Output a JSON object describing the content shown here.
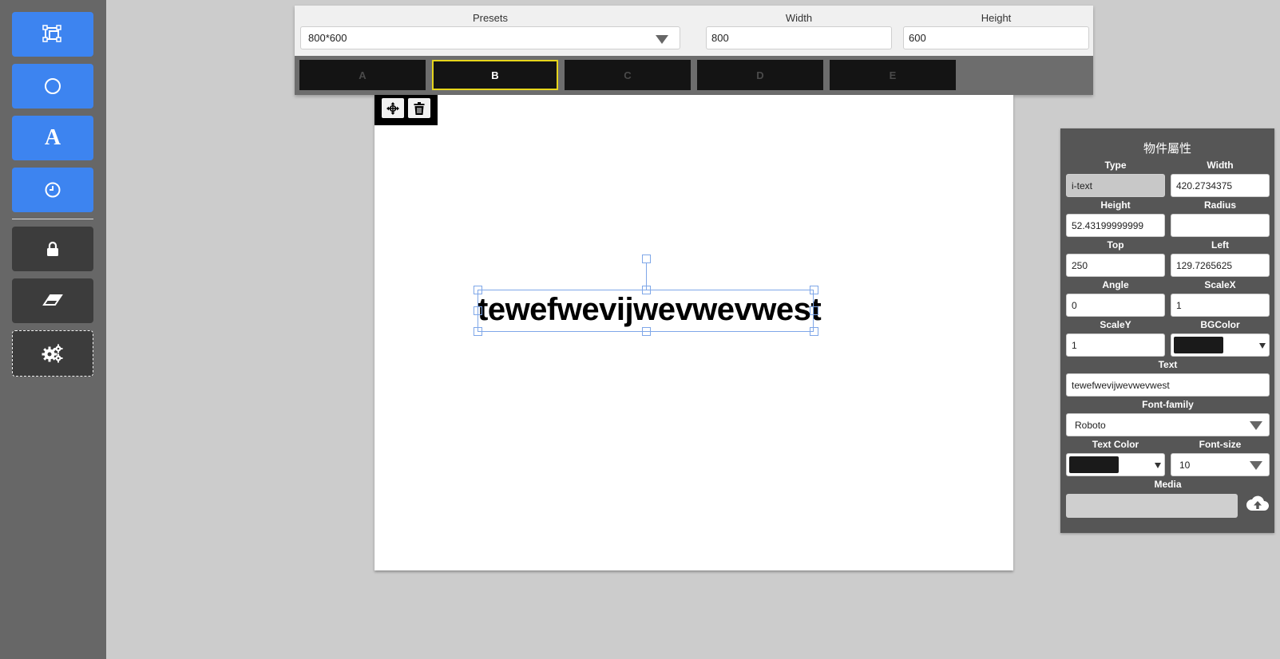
{
  "sidebar": {
    "tools": [
      {
        "name": "select-frame-icon",
        "style": "blue"
      },
      {
        "name": "circle-icon",
        "style": "blue"
      },
      {
        "name": "text-tool-icon",
        "glyph": "A",
        "style": "blue"
      },
      {
        "name": "clock-icon",
        "style": "blue"
      },
      {
        "name": "lock-icon",
        "style": "dark"
      },
      {
        "name": "eraser-icon",
        "style": "dark"
      },
      {
        "name": "gears-icon",
        "style": "outlined"
      }
    ],
    "text_tool_glyph": "A"
  },
  "topbar": {
    "presets_label": "Presets",
    "presets_value": "800*600",
    "width_label": "Width",
    "width_value": "800",
    "height_label": "Height",
    "height_value": "600",
    "tabs": [
      {
        "label": "A"
      },
      {
        "label": "B",
        "active": true
      },
      {
        "label": "C"
      },
      {
        "label": "D"
      },
      {
        "label": "E"
      }
    ]
  },
  "canvas": {
    "text_object": "tewefwevijwevwevwest",
    "toolbar_icons": [
      "move-icon",
      "trash-icon"
    ]
  },
  "properties": {
    "title": "物件屬性",
    "type_label": "Type",
    "type_value": "i-text",
    "width_label": "Width",
    "width_value": "420.2734375",
    "height_label": "Height",
    "height_value": "52.43199999999",
    "radius_label": "Radius",
    "radius_value": "",
    "top_label": "Top",
    "top_value": "250",
    "left_label": "Left",
    "left_value": "129.7265625",
    "angle_label": "Angle",
    "angle_value": "0",
    "scalex_label": "ScaleX",
    "scalex_value": "1",
    "scaley_label": "ScaleY",
    "scaley_value": "1",
    "bgcolor_label": "BGColor",
    "bgcolor_value": "#1a1a1a",
    "text_label": "Text",
    "text_value": "tewefwevijwevwevwest",
    "fontfamily_label": "Font-family",
    "fontfamily_value": "Roboto",
    "textcolor_label": "Text Color",
    "textcolor_value": "#1a1a1a",
    "fontsize_label": "Font-size",
    "fontsize_value": "10",
    "media_label": "Media"
  },
  "colors": {
    "tool_blue": "#3d84f0",
    "tool_dark": "#3c3c3c",
    "sidebar": "#676767",
    "active_tab_border": "#e6d51c",
    "selection": "#7fa7e8",
    "panel": "#565656"
  }
}
